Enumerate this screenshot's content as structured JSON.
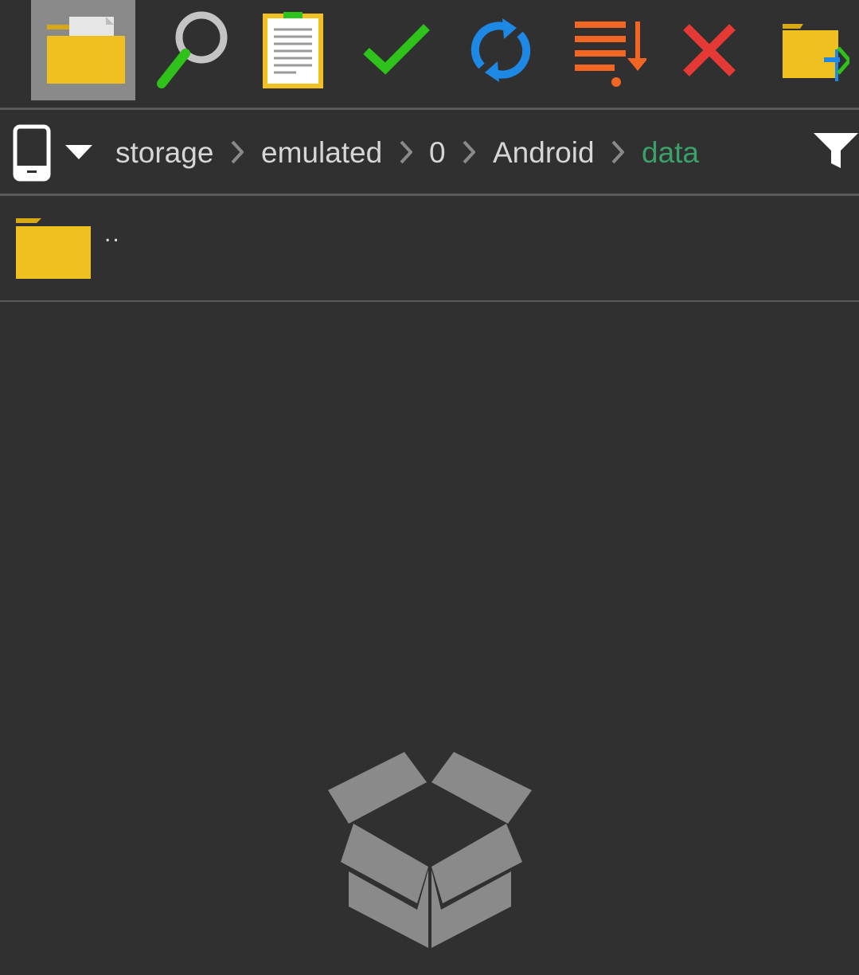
{
  "toolbar": {
    "tools": [
      {
        "name": "folder",
        "active": true
      },
      {
        "name": "search"
      },
      {
        "name": "clipboard"
      },
      {
        "name": "select-all"
      },
      {
        "name": "refresh"
      },
      {
        "name": "sort"
      },
      {
        "name": "close"
      },
      {
        "name": "move-to"
      }
    ]
  },
  "path": {
    "device_icon": "phone-icon",
    "crumbs": [
      "storage",
      "emulated",
      "0",
      "Android",
      "data"
    ],
    "current": "data"
  },
  "list": {
    "items": [
      {
        "name": "..",
        "icon": "folder-icon"
      }
    ]
  },
  "empty_state": {
    "icon": "empty-box-icon"
  },
  "colors": {
    "background": "#303030",
    "folder": "#f0c020",
    "current_crumb": "#3aa16a",
    "divider": "#5a5a5a"
  }
}
